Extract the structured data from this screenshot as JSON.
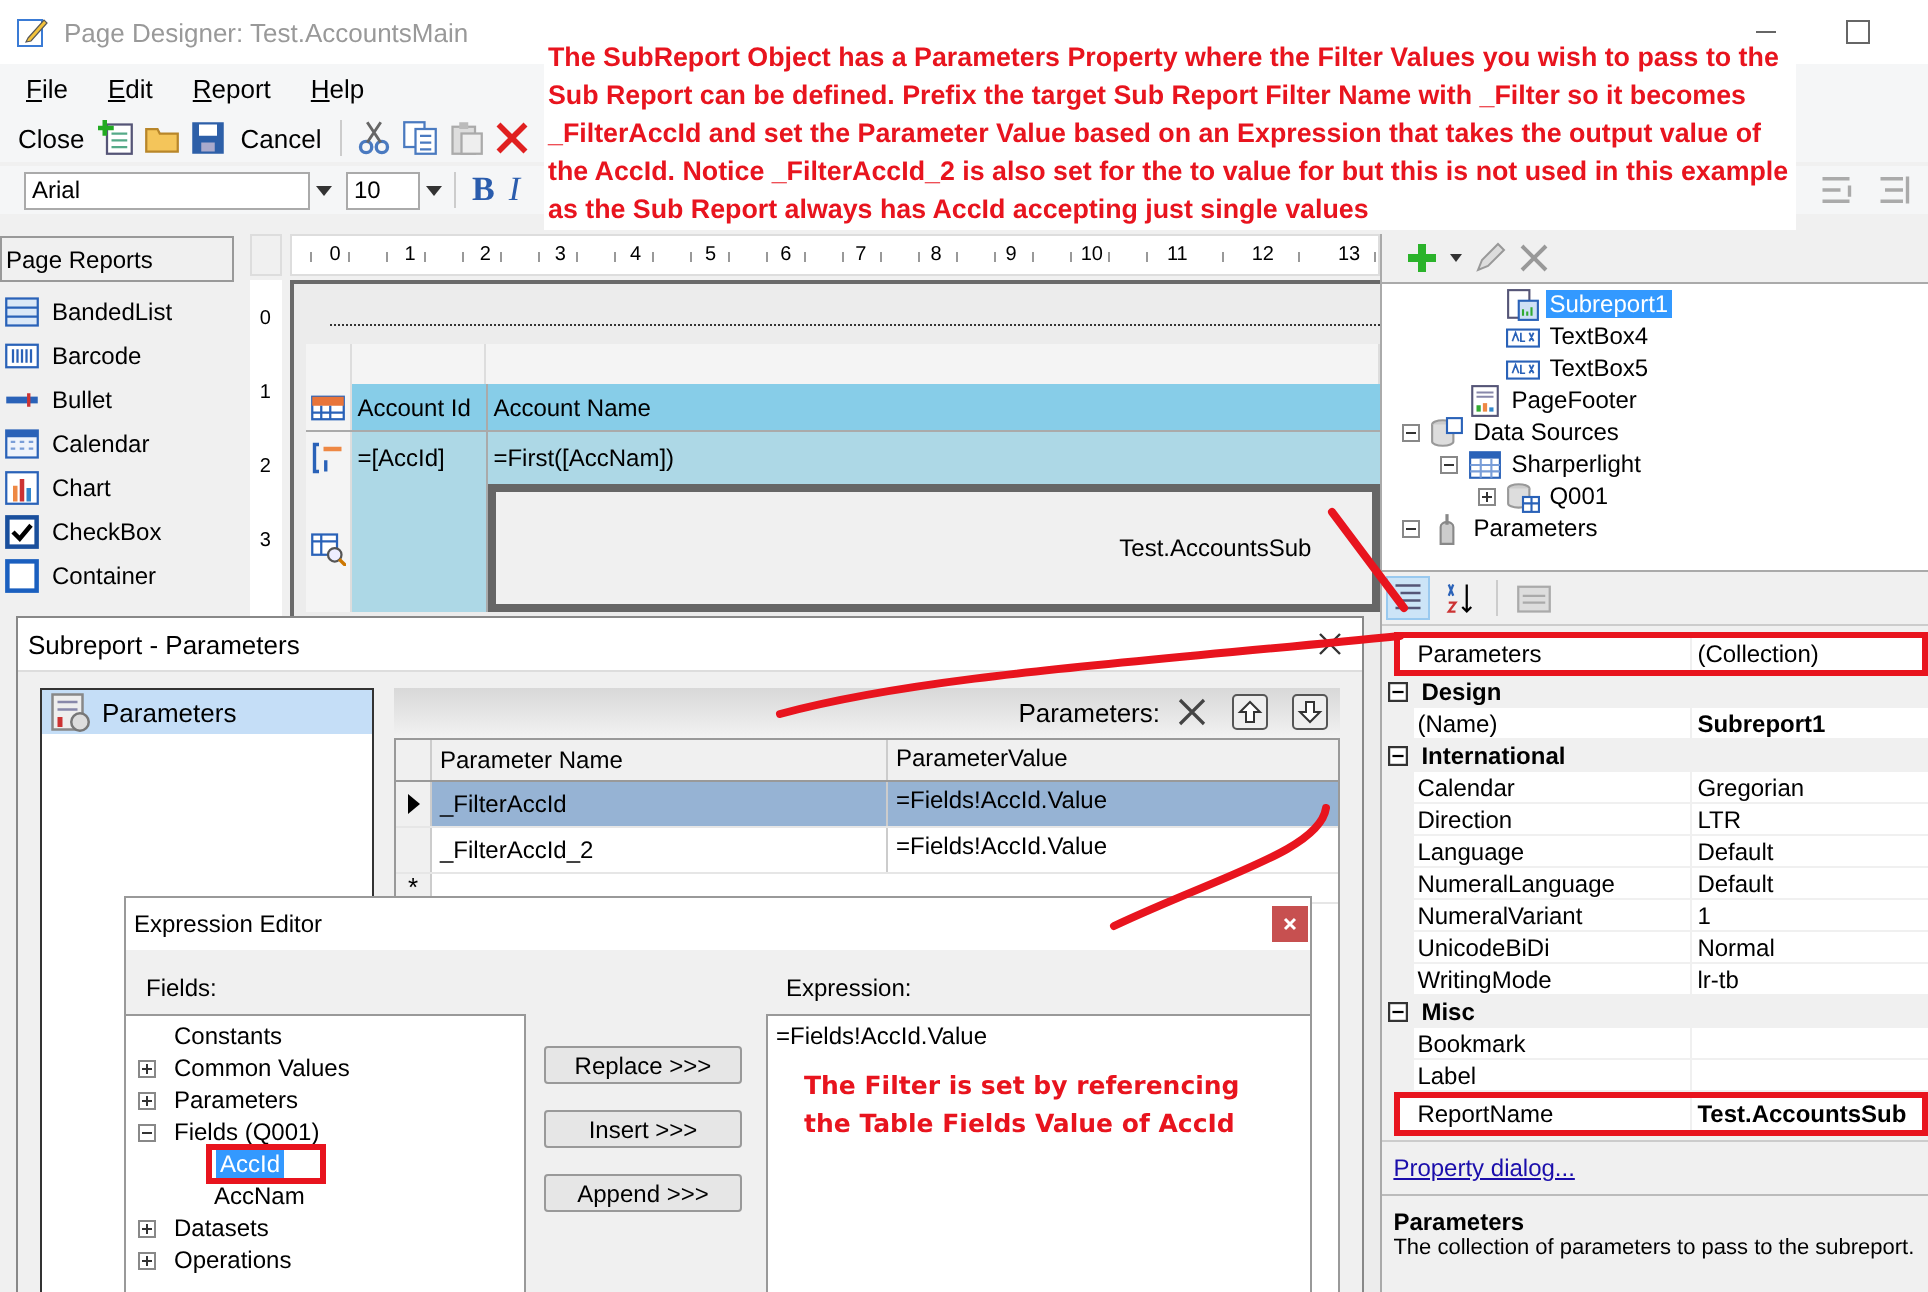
{
  "window": {
    "title": "Page Designer: Test.AccountsMain"
  },
  "menu": [
    {
      "label": "File"
    },
    {
      "label": "Edit"
    },
    {
      "label": "Report"
    },
    {
      "label": "Help"
    }
  ],
  "toolbar": [
    {
      "kind": "button",
      "label": "Close"
    },
    {
      "kind": "new"
    },
    {
      "kind": "open"
    },
    {
      "kind": "save"
    },
    {
      "kind": "button",
      "label": "Cancel"
    },
    {
      "kind": "separator"
    },
    {
      "kind": "cut"
    },
    {
      "kind": "copy"
    },
    {
      "kind": "paste"
    },
    {
      "kind": "delete"
    }
  ],
  "format_bar": {
    "font": "Arial",
    "size": "10",
    "bold": "B",
    "italic": "I"
  },
  "annotation": "The SubReport Object has a Parameters Property where the Filter Values you wish to pass to the Sub Report can be defined. Prefix the target Sub Report Filter Name with _Filter so it becomes _FilterAccId and set the Parameter Value based on an Expression that takes the output value of the AccId. Notice _FilterAccId_2 is also set for the to value for but this is not used in this example as the Sub Report always has AccId accepting just single values",
  "toolbox": {
    "title": "Page Reports",
    "items": [
      {
        "kind": "banded",
        "label": "BandedList"
      },
      {
        "kind": "barcode",
        "label": "Barcode"
      },
      {
        "kind": "bullet",
        "label": "Bullet"
      },
      {
        "kind": "calendar",
        "label": "Calendar"
      },
      {
        "kind": "chart",
        "label": "Chart"
      },
      {
        "kind": "checkbox",
        "label": "CheckBox"
      },
      {
        "kind": "container",
        "label": "Container"
      }
    ]
  },
  "ruler": {
    "marks": [
      "0",
      "1",
      "2",
      "3",
      "4",
      "5",
      "6",
      "7",
      "8",
      "9",
      "10",
      "11",
      "12",
      "13"
    ],
    "side_marks": [
      "0",
      "1",
      "2",
      "3"
    ]
  },
  "design": {
    "rows": [
      {
        "kind": "header",
        "cells": [
          "Account Id",
          "Account Name"
        ]
      },
      {
        "kind": "detail",
        "cells": [
          "=[AccId]",
          "=First([AccNam])"
        ]
      },
      {
        "kind": "subreport",
        "report": "Test.AccountsSub"
      }
    ]
  },
  "outline": {
    "tree": [
      {
        "children": [
          {
            "children": [
              {
                "kind": "subreport",
                "label": "Subreport1",
                "selected": true
              },
              {
                "kind": "textbox",
                "label": "TextBox4",
                "selected": false
              },
              {
                "kind": "textbox",
                "label": "TextBox5",
                "selected": false
              }
            ]
          },
          {
            "kind": "section",
            "label": "PageFooter",
            "selected": false
          }
        ]
      },
      {
        "kind": "datasource",
        "label": "Data Sources",
        "selected": false,
        "expanded": true,
        "children": [
          {
            "kind": "table",
            "label": "Sharperlight",
            "selected": false,
            "expanded": true,
            "children": [
              {
                "kind": "query",
                "label": "Q001",
                "selected": false,
                "expanded": false
              }
            ]
          }
        ]
      },
      {
        "kind": "parameters",
        "label": "Parameters",
        "selected": false,
        "expanded": true
      }
    ]
  },
  "properties": {
    "rows": [
      {
        "kind": "property",
        "name": "Parameters",
        "value": "(Collection)",
        "bold": false,
        "highlighted": true
      },
      {
        "kind": "category",
        "label": "Design",
        "expanded": true
      },
      {
        "kind": "property",
        "name": "(Name)",
        "value": "Subreport1",
        "bold": true,
        "highlighted": false
      },
      {
        "kind": "category",
        "label": "International",
        "expanded": true
      },
      {
        "kind": "property",
        "name": "Calendar",
        "value": "Gregorian",
        "bold": false,
        "highlighted": false
      },
      {
        "kind": "property",
        "name": "Direction",
        "value": "LTR",
        "bold": false,
        "highlighted": false
      },
      {
        "kind": "property",
        "name": "Language",
        "value": "Default",
        "bold": false,
        "highlighted": false
      },
      {
        "kind": "property",
        "name": "NumeralLanguage",
        "value": "Default",
        "bold": false,
        "highlighted": false
      },
      {
        "kind": "property",
        "name": "NumeralVariant",
        "value": "1",
        "bold": false,
        "highlighted": false
      },
      {
        "kind": "property",
        "name": "UnicodeBiDi",
        "value": "Normal",
        "bold": false,
        "highlighted": false
      },
      {
        "kind": "property",
        "name": "WritingMode",
        "value": "lr-tb",
        "bold": false,
        "highlighted": false
      },
      {
        "kind": "category",
        "label": "Misc",
        "expanded": true
      },
      {
        "kind": "property",
        "name": "Bookmark",
        "highlighted": false
      },
      {
        "kind": "property",
        "name": "Label",
        "highlighted": false
      },
      {
        "kind": "property",
        "name": "ReportName",
        "value": "Test.AccountsSub",
        "bold": true,
        "highlighted": true
      }
    ],
    "link": "Property dialog...",
    "description": {
      "title": "Parameters",
      "text": "The collection of parameters to pass to the subreport."
    }
  },
  "parameters_dialog": {
    "title": "Subreport - Parameters",
    "pages": [
      {
        "label": "Parameters",
        "selected": true
      }
    ],
    "grid_label": "Parameters:",
    "columns": [
      "Parameter Name",
      "ParameterValue"
    ],
    "rows": [
      {
        "name": "_FilterAccId",
        "value": "=Fields!AccId.Value",
        "selected": true
      },
      {
        "name": "_FilterAccId_2",
        "value": "=Fields!AccId.Value",
        "selected": false
      }
    ],
    "new_row": "*"
  },
  "expression_editor": {
    "title": "Expression Editor",
    "fields_label": "Fields:",
    "expression_label": "Expression:",
    "fields": [
      {
        "label": "Constants",
        "selected": false,
        "highlighted": false
      },
      {
        "label": "Common Values",
        "selected": false,
        "highlighted": false,
        "expanded": false
      },
      {
        "label": "Parameters",
        "selected": false,
        "highlighted": false,
        "expanded": false
      },
      {
        "label": "Fields (Q001)",
        "selected": false,
        "highlighted": false,
        "expanded": true,
        "children": [
          {
            "label": "AccId",
            "selected": true,
            "highlighted": true
          },
          {
            "label": "AccNam",
            "selected": false,
            "highlighted": false
          }
        ]
      },
      {
        "label": "Datasets",
        "selected": false,
        "highlighted": false,
        "expanded": false
      },
      {
        "label": "Operations",
        "selected": false,
        "highlighted": false,
        "expanded": false
      }
    ],
    "buttons": [
      "Replace >>>",
      "Insert >>>",
      "Append >>>"
    ],
    "expression": "=Fields!AccId.Value",
    "note": "The Filter is set by referencing the Table Fields Value of AccId"
  }
}
